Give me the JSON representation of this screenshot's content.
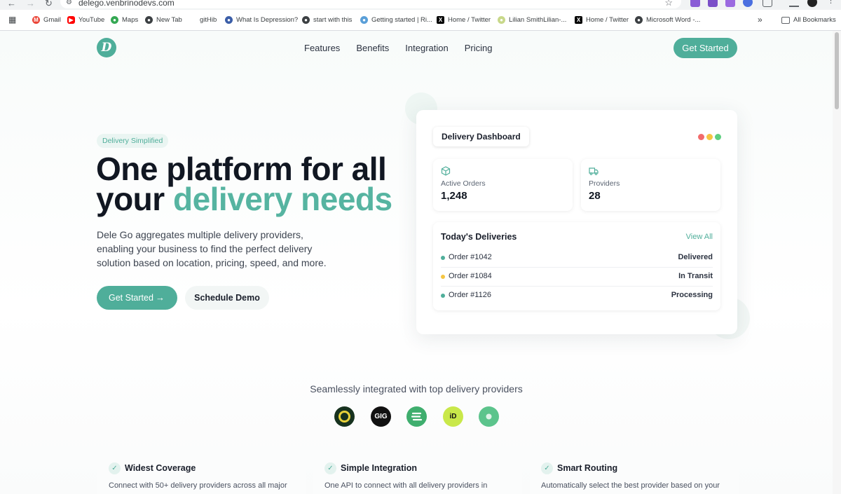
{
  "browser": {
    "url": "delego.venbrinodevs.com",
    "bookmarks": [
      {
        "label": "Gmail",
        "icon": "gmail-icon"
      },
      {
        "label": "YouTube",
        "icon": "youtube-icon"
      },
      {
        "label": "Maps",
        "icon": "maps-icon"
      },
      {
        "label": "New Tab",
        "icon": "globe-icon"
      },
      {
        "label": "gitHib",
        "icon": "blank-icon"
      },
      {
        "label": "What Is Depression?",
        "icon": "site-icon"
      },
      {
        "label": "start with this",
        "icon": "globe-icon"
      },
      {
        "label": "Getting started | Ri...",
        "icon": "site-icon"
      },
      {
        "label": "Home / Twitter",
        "icon": "x-icon"
      },
      {
        "label": "Lilian SmithLilian-...",
        "icon": "site-icon"
      },
      {
        "label": "Home / Twitter",
        "icon": "x-icon"
      },
      {
        "label": "Microsoft Word -...",
        "icon": "globe-icon"
      }
    ],
    "all_bookmarks": "All Bookmarks"
  },
  "nav": {
    "logo_letter": "D",
    "links": [
      "Features",
      "Benefits",
      "Integration",
      "Pricing"
    ],
    "cta": "Get Started"
  },
  "hero": {
    "badge": "Delivery Simplified",
    "title_line1": "One platform for all",
    "title_line2_plain": "your ",
    "title_line2_accent": "delivery needs",
    "subtitle": "Dele Go aggregates multiple delivery providers, enabling your business to find the perfect delivery solution based on location, pricing, speed, and more.",
    "primary_button": "Get Started",
    "secondary_button": "Schedule Demo"
  },
  "dashboard": {
    "title": "Delivery Dashboard",
    "window_dots": [
      "#f26b6b",
      "#f5c542",
      "#5fcf80"
    ],
    "stats": [
      {
        "label": "Active Orders",
        "value": "1,248",
        "icon": "package-icon"
      },
      {
        "label": "Providers",
        "value": "28",
        "icon": "truck-icon"
      }
    ],
    "deliveries_title": "Today's Deliveries",
    "view_all": "View All",
    "deliveries": [
      {
        "order": "Order #1042",
        "status": "Delivered",
        "dot_color": "#4fae9a"
      },
      {
        "order": "Order #1084",
        "status": "In Transit",
        "dot_color": "#f5c542"
      },
      {
        "order": "Order #1126",
        "status": "Processing",
        "dot_color": "#4fae9a"
      }
    ]
  },
  "integrations": {
    "heading": "Seamlessly integrated with top delivery providers",
    "partners": [
      {
        "name": "partner-1",
        "text": "",
        "bg": "#17321f"
      },
      {
        "name": "partner-gig",
        "text": "GIG",
        "bg": "#111111"
      },
      {
        "name": "partner-3",
        "text": "",
        "bg": "#3fae6e"
      },
      {
        "name": "partner-4",
        "text": "iD",
        "bg": "#c9e84a"
      },
      {
        "name": "partner-5",
        "text": "",
        "bg": "#5cc48c"
      }
    ]
  },
  "features": [
    {
      "title": "Widest Coverage",
      "desc": "Connect with 50+ delivery providers across all major"
    },
    {
      "title": "Simple Integration",
      "desc": "One API to connect with all delivery providers in"
    },
    {
      "title": "Smart Routing",
      "desc": "Automatically select the best provider based on your"
    }
  ]
}
